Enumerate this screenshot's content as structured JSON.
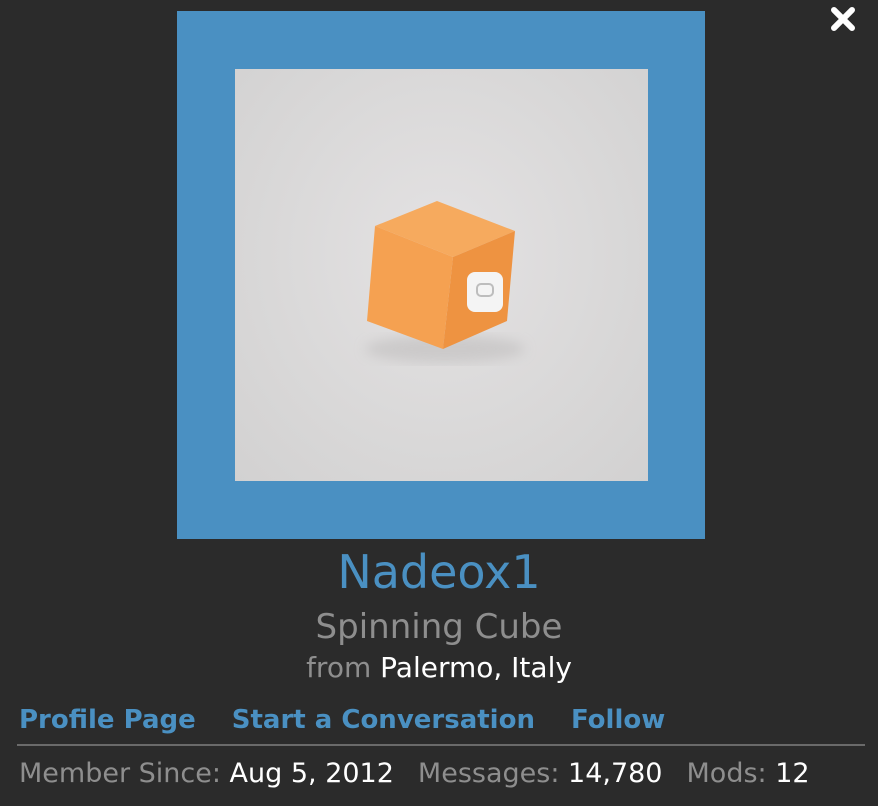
{
  "close": {
    "icon": "close-icon"
  },
  "avatar": {
    "description_icon": "orange-cube-avatar"
  },
  "user": {
    "name": "Nadeox1",
    "title": "Spinning Cube",
    "from_label": "from",
    "location": "Palermo, Italy"
  },
  "links": {
    "profile": "Profile Page",
    "conversation": "Start a Conversation",
    "follow": "Follow"
  },
  "stats": {
    "member_since_label": "Member Since:",
    "member_since_value": "Aug 5, 2012",
    "messages_label": "Messages:",
    "messages_value": "14,780",
    "mods_label": "Mods:",
    "mods_value": "12"
  },
  "colors": {
    "background": "#2b2b2b",
    "accent": "#4a90c2",
    "muted": "#8e8e8e",
    "text": "#ffffff"
  }
}
